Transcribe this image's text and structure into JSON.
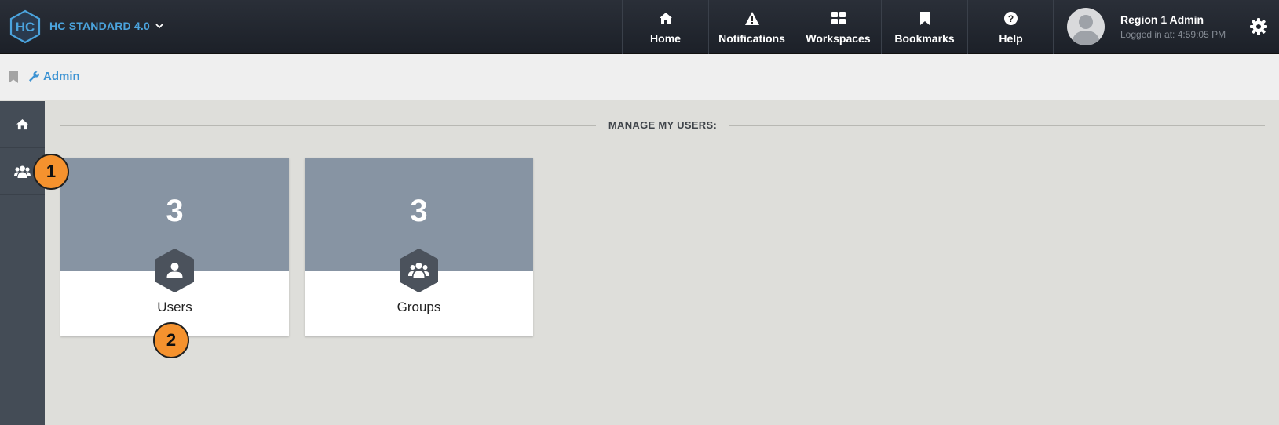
{
  "header": {
    "logo_text": "HC",
    "brand": "HC STANDARD 4.0",
    "nav": [
      {
        "label": "Home",
        "icon": "home-icon"
      },
      {
        "label": "Notifications",
        "icon": "warning-icon"
      },
      {
        "label": "Workspaces",
        "icon": "grid-icon"
      },
      {
        "label": "Bookmarks",
        "icon": "bookmark-icon"
      },
      {
        "label": "Help",
        "icon": "help-icon"
      }
    ],
    "user": {
      "name": "Region 1 Admin",
      "logged_in": "Logged in at: 4:59:05 PM"
    }
  },
  "breadcrumb": {
    "label": "Admin"
  },
  "sidebar": {
    "items": [
      {
        "icon": "home-icon"
      },
      {
        "icon": "users-icon"
      }
    ]
  },
  "main": {
    "section_title": "MANAGE MY USERS:",
    "cards": [
      {
        "count": "3",
        "label": "Users",
        "icon": "user-icon"
      },
      {
        "count": "3",
        "label": "Groups",
        "icon": "group-icon"
      }
    ]
  },
  "callouts": [
    "1",
    "2"
  ],
  "colors": {
    "accent": "#3d93d3",
    "topbar": "#1f232b",
    "card_top": "#8794a3",
    "callout": "#f5922e"
  }
}
